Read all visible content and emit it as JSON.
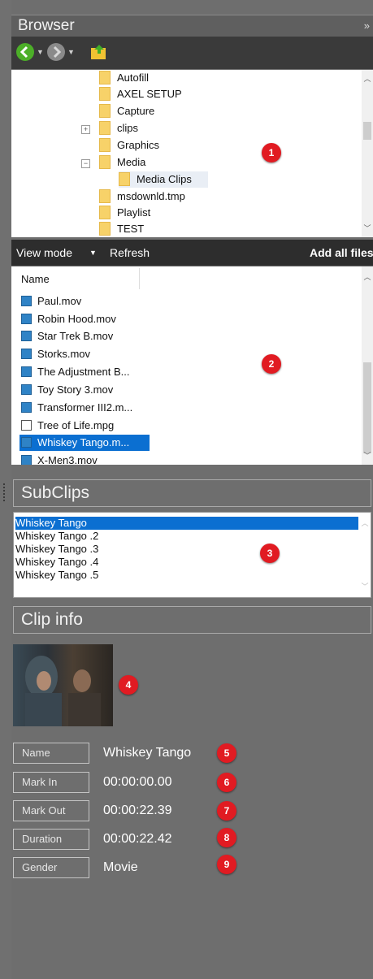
{
  "browser": {
    "title": "Browser",
    "collapse_glyph": "»",
    "toolbar": {
      "back_icon": "back-arrow-icon",
      "forward_icon": "forward-arrow-icon",
      "folder_icon": "folder-up-icon"
    },
    "tree": [
      {
        "label": "Autofill",
        "expander": ""
      },
      {
        "label": "AXEL SETUP",
        "expander": ""
      },
      {
        "label": "Capture",
        "expander": ""
      },
      {
        "label": "clips",
        "expander": "+"
      },
      {
        "label": "Graphics",
        "expander": ""
      },
      {
        "label": "Media",
        "expander": "−"
      },
      {
        "label": "Media Clips",
        "expander": ""
      },
      {
        "label": "msdownld.tmp",
        "expander": ""
      },
      {
        "label": "Playlist",
        "expander": ""
      },
      {
        "label": "TEST",
        "expander": ""
      }
    ],
    "actions": {
      "view_mode": "View mode",
      "view_mode_arrow": "▼",
      "refresh": "Refresh",
      "add_all": "Add all files"
    },
    "files_header": "Name",
    "files": [
      "Paul.mov",
      "Robin Hood.mov",
      "Star Trek B.mov",
      "Storks.mov",
      "The Adjustment B...",
      "Toy Story 3.mov",
      "Transformer III2.m...",
      "Tree of Life.mpg",
      "Whiskey Tango.m...",
      "X-Men3.mov"
    ],
    "selected_file": "Whiskey Tango.m..."
  },
  "subclips": {
    "title": "SubClips",
    "items": [
      "Whiskey Tango",
      "Whiskey Tango .2",
      "Whiskey Tango .3",
      "Whiskey Tango .4",
      "Whiskey Tango .5"
    ],
    "selected": "Whiskey Tango"
  },
  "clip_info": {
    "title": "Clip info",
    "fields": [
      {
        "label": "Name",
        "value": "Whiskey Tango"
      },
      {
        "label": "Mark In",
        "value": "00:00:00.00"
      },
      {
        "label": "Mark Out",
        "value": "00:00:22.39"
      },
      {
        "label": "Duration",
        "value": "00:00:22.42"
      },
      {
        "label": "Gender",
        "value": "Movie"
      }
    ]
  },
  "badges": [
    "1",
    "2",
    "3",
    "4",
    "5",
    "6",
    "7",
    "8",
    "9"
  ],
  "colors": {
    "selection": "#0b6fd1",
    "badge": "#e11b22",
    "panel_bg": "#6e6e6e"
  }
}
